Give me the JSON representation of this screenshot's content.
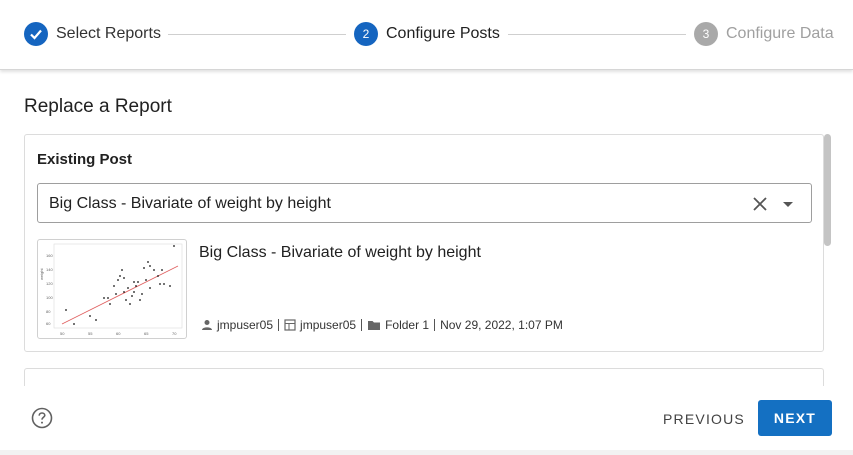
{
  "stepper": {
    "steps": [
      {
        "number": "",
        "label": "Select Reports",
        "state": "complete",
        "icon": "check-icon"
      },
      {
        "number": "2",
        "label": "Configure Posts",
        "state": "active"
      },
      {
        "number": "3",
        "label": "Configure Data",
        "state": "disabled"
      }
    ]
  },
  "page": {
    "title": "Replace a Report"
  },
  "existing_post": {
    "section_title": "Existing Post",
    "select_value": "Big Class - Bivariate of weight by height",
    "post_title": "Big Class - Bivariate of weight by height",
    "author": "jmpuser05",
    "space": "jmpuser05",
    "folder": "Folder 1",
    "date": "Nov 29, 2022, 1:07 PM",
    "thumbnail": {
      "x_ticks": [
        "50",
        "55",
        "60",
        "65",
        "70"
      ],
      "y_ticks": [
        "160",
        "140",
        "120",
        "100",
        "80",
        "60"
      ],
      "y_label": "weight"
    }
  },
  "footer": {
    "previous_label": "PREVIOUS",
    "next_label": "NEXT",
    "help_icon": "help-circle-icon"
  },
  "colors": {
    "primary": "#1470c2",
    "step_active": "#1565c0",
    "step_disabled": "#a9a9a9",
    "fit_line": "#e06060"
  }
}
